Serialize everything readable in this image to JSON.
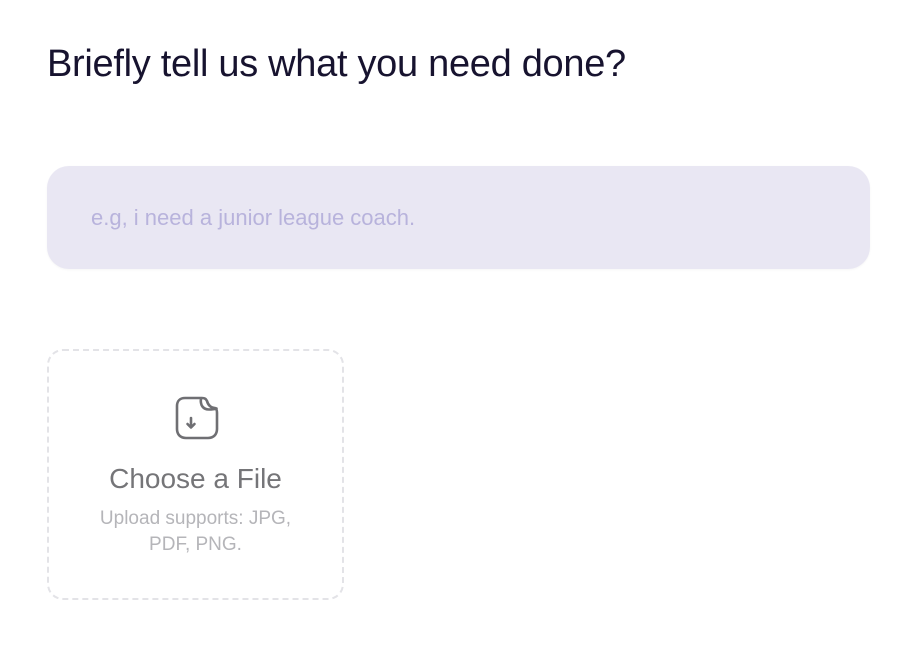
{
  "question": {
    "title": "Briefly tell us what you need done?"
  },
  "description_input": {
    "value": "",
    "placeholder": "e.g, i need a junior league coach."
  },
  "upload": {
    "title": "Choose a File",
    "subtitle": "Upload supports: JPG, PDF, PNG.",
    "icon": "file-download-icon"
  }
}
